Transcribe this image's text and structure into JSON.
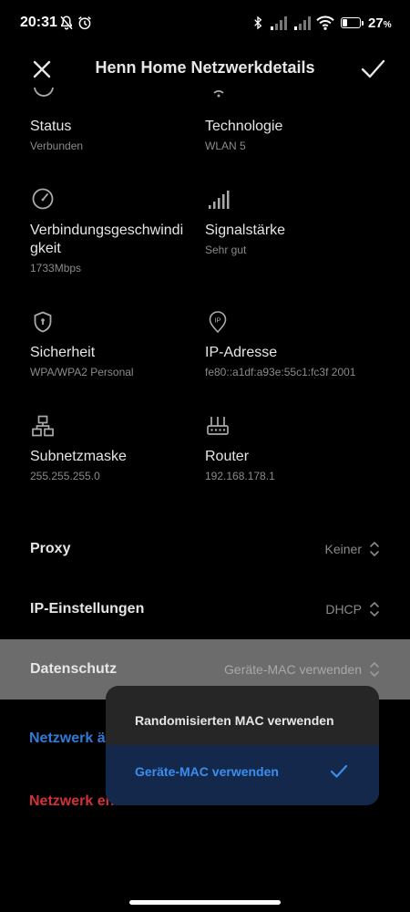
{
  "status_bar": {
    "time": "20:31",
    "battery_percent": "27",
    "battery_unit": "%",
    "battery_level": 0.27,
    "icons": [
      "mute-bell-icon",
      "alarm-icon",
      "bluetooth-icon",
      "signal-icon",
      "signal-icon",
      "wifi-icon",
      "battery-icon"
    ]
  },
  "header": {
    "title": "Henn Home Netzwerkdetails",
    "close_icon": "close-icon",
    "confirm_icon": "check-icon"
  },
  "details": [
    {
      "label": "Status",
      "value": "Verbunden",
      "icon": "status-icon"
    },
    {
      "label": "Technologie",
      "value": "WLAN 5",
      "icon": "wifi-icon"
    },
    {
      "label": "Verbindungsgeschwindi\ngkeit",
      "value": "1733Mbps",
      "icon": "speedometer-icon"
    },
    {
      "label": "Signalstärke",
      "value": "Sehr gut",
      "icon": "signal-strength-icon"
    },
    {
      "label": "Sicherheit",
      "value": "WPA/WPA2 Personal",
      "icon": "shield-icon"
    },
    {
      "label": "IP-Adresse",
      "value": "fe80::a1df:a93e:55c1:fc3f 2001",
      "icon": "ip-pin-icon"
    },
    {
      "label": "Subnetzmaske",
      "value": "255.255.255.0",
      "icon": "network-tree-icon"
    },
    {
      "label": "Router",
      "value": "192.168.178.1",
      "icon": "router-icon"
    }
  ],
  "settings": {
    "proxy": {
      "label": "Proxy",
      "value": "Keiner"
    },
    "ip": {
      "label": "IP-Einstellungen",
      "value": "DHCP"
    },
    "privacy": {
      "label": "Datenschutz",
      "value": "Geräte-MAC verwenden"
    }
  },
  "actions": {
    "modify": "Netzwerk ä",
    "remove": "Netzwerk entfernen"
  },
  "popup": {
    "options": [
      {
        "label": "Randomisierten MAC verwenden",
        "selected": false
      },
      {
        "label": "Geräte-MAC verwenden",
        "selected": true
      }
    ]
  },
  "colors": {
    "accent_blue": "#2e7bd8",
    "danger_red": "#d3303a",
    "background": "#000000",
    "highlight_row": "#6c6c6c",
    "popup_bg": "#262626",
    "popup_selected": "#13284a"
  }
}
